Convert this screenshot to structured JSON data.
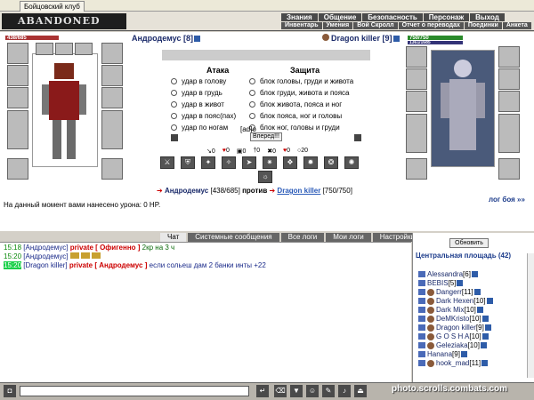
{
  "browser": {
    "tabs": [
      "Бойцовский клуб"
    ]
  },
  "header": {
    "logo": "ABANDONED PLAIN",
    "menu": [
      "Знания",
      "Общение",
      "Безопасность",
      "Персонаж",
      "Выход"
    ],
    "submenu": [
      "Инвентарь",
      "Умения",
      "Вой Скролл",
      "Отчет о переводах",
      "Поединки",
      "Анкета"
    ]
  },
  "player": {
    "hp": "438/685",
    "name": "Андродемус [8]"
  },
  "enemy": {
    "hp": "750/750",
    "mp": "1361/1685",
    "name": "Dragon killer [9]"
  },
  "combat": {
    "attack_title": "Атака",
    "defense_title": "Защита",
    "attacks": [
      "удар в голову",
      "удар в грудь",
      "удар в живот",
      "удар в пояс(пах)",
      "удар по ногам"
    ],
    "defenses": [
      "блок головы, груди и живота",
      "блок груди, живота и пояса",
      "блок живота, пояса и ног",
      "блок пояса, ног и головы",
      "блок ног, головы и груди"
    ],
    "mode": "[ad]o",
    "forward_label": "Вперед!!!",
    "stats": [
      {
        "icon": "arrow",
        "value": "0"
      },
      {
        "icon": "heart",
        "value": "0"
      },
      {
        "icon": "shield",
        "value": "0"
      },
      {
        "icon": "sword",
        "value": "0"
      },
      {
        "icon": "cross",
        "value": "0"
      },
      {
        "icon": "heart2",
        "value": "0"
      },
      {
        "icon": "ring",
        "value": "20"
      }
    ]
  },
  "battle": {
    "player_name": "Андродемус",
    "player_hp": "[438/685]",
    "vs": "против",
    "enemy_name": "Dragon killer",
    "enemy_hp": "[750/750]",
    "damage_text": "На данный момент вами нанесено урона: 0 HP.",
    "log_link": "лог боя »»"
  },
  "chat": {
    "tabs": [
      "Чат",
      "Системные сообщения",
      "Все логи",
      "Мои логи",
      "Настройки"
    ],
    "lines": [
      {
        "time": "15:18",
        "nick": "[Андродемус]",
        "priv": "private [ Офигенно ]",
        "text": "2кр на 3 ч"
      },
      {
        "time": "15:20",
        "nick": "[Андродемус]",
        "priv": "",
        "text": ""
      },
      {
        "time": "15:20",
        "nick": "[Dragon killer]",
        "priv": "private [ Андродемус ]",
        "text": "если сольеш дам 2 банки инты +22"
      }
    ]
  },
  "people": {
    "refresh_label": "Обновить",
    "title": "Центральная площадь (42)",
    "list": [
      {
        "name": "Alessandra",
        "level": "[6]"
      },
      {
        "name": "BEBIS",
        "level": "[5]"
      },
      {
        "name": "Dangerr",
        "level": "[11]"
      },
      {
        "name": "Dark Hexen",
        "level": "[10]"
      },
      {
        "name": "Dark Mix",
        "level": "[10]"
      },
      {
        "name": "DeMKristo",
        "level": "[10]"
      },
      {
        "name": "Dragon killer",
        "level": "[9]"
      },
      {
        "name": "G O S H A",
        "level": "[10]"
      },
      {
        "name": "Geleziaka",
        "level": "[10]"
      },
      {
        "name": "Hanana",
        "level": "[9]"
      },
      {
        "name": "hook_mad",
        "level": "[11]"
      }
    ]
  },
  "watermark": "photo.scrolls.combats.com",
  "colors": {
    "accent": "#1a2a6a",
    "private": "#cc0000",
    "time": "#0a8a0a"
  }
}
